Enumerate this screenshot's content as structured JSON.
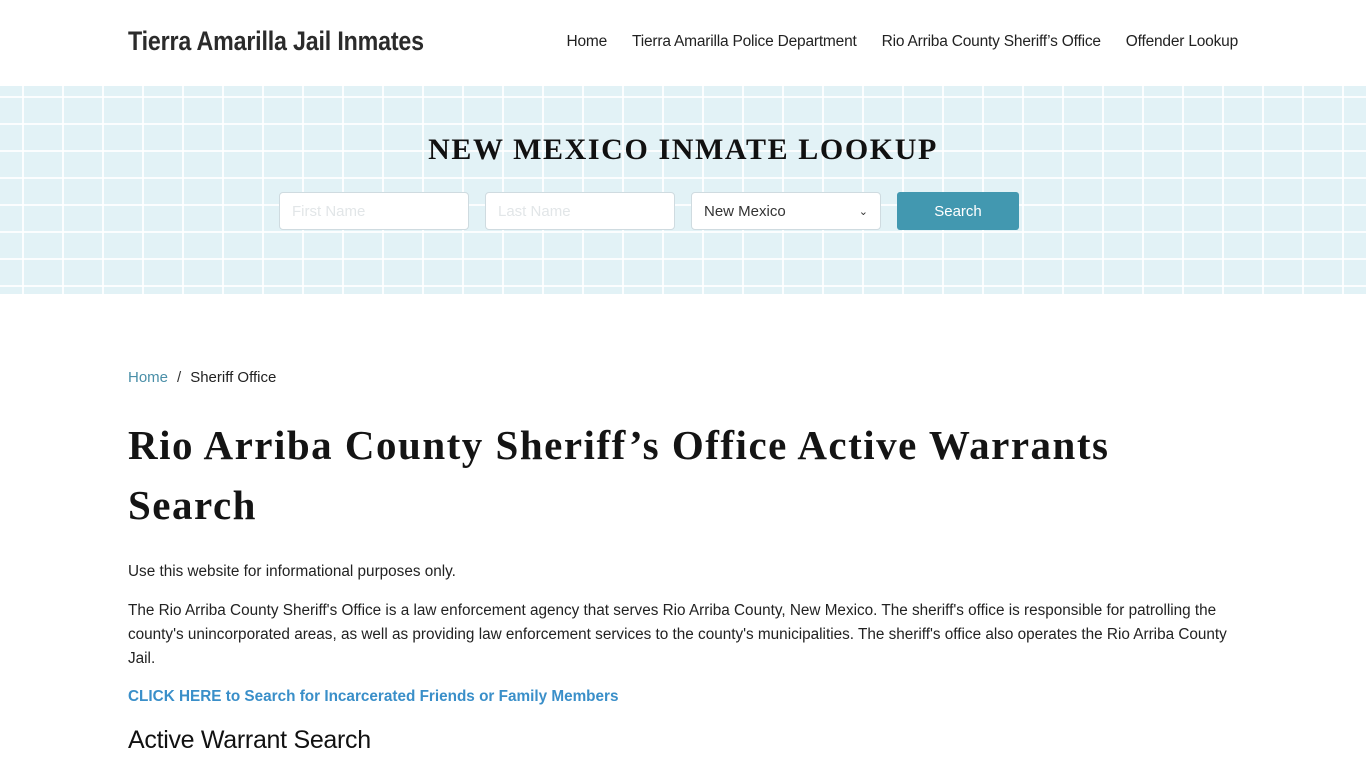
{
  "header": {
    "site_title": "Tierra Amarilla Jail Inmates",
    "nav": [
      {
        "label": "Home"
      },
      {
        "label": "Tierra Amarilla Police Department"
      },
      {
        "label": "Rio Arriba County Sheriff’s Office"
      },
      {
        "label": "Offender Lookup"
      }
    ]
  },
  "hero": {
    "title": "NEW MEXICO INMATE LOOKUP",
    "first_name_placeholder": "First Name",
    "last_name_placeholder": "Last Name",
    "state_selected": "New Mexico",
    "search_label": "Search"
  },
  "breadcrumb": {
    "home": "Home",
    "separator": "/",
    "current": "Sheriff Office"
  },
  "main": {
    "title": "Rio Arriba County Sheriff’s Office Active Warrants Search",
    "disclaimer": "Use this website for informational purposes only.",
    "description": "The Rio Arriba County Sheriff's Office is a law enforcement agency that serves Rio Arriba County, New Mexico. The sheriff's office is responsible for patrolling the county's unincorporated areas, as well as providing law enforcement services to the county's municipalities. The sheriff's office also operates the Rio Arriba County Jail.",
    "cta_link": "CLICK HERE to Search for Incarcerated Friends or Family Members",
    "section_title": "Active Warrant Search"
  },
  "colors": {
    "accent": "#4298b0",
    "link": "#3a8fc9",
    "hero_bg": "#e2f2f6"
  }
}
